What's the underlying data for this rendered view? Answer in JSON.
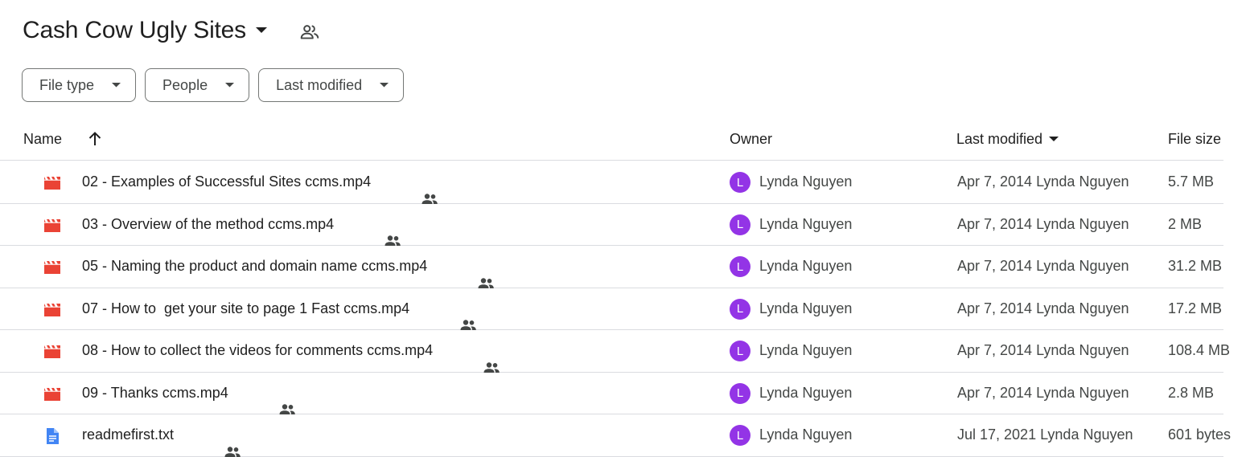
{
  "header": {
    "title": "Cash Cow Ugly Sites",
    "title_caret_icon": "caret-down-icon",
    "share_icon": "people-outline-icon"
  },
  "filters": [
    {
      "label": "File type"
    },
    {
      "label": "People"
    },
    {
      "label": "Last modified"
    }
  ],
  "columns": {
    "name": "Name",
    "owner": "Owner",
    "modified": "Last modified",
    "size": "File size"
  },
  "colors": {
    "video_icon": "#ea4335",
    "doc_icon": "#4285f4",
    "avatar": "#9334e6"
  },
  "files": [
    {
      "icon": "video-icon",
      "name": "02 - Examples of Successful Sites ccms.mp4",
      "owner_initial": "L",
      "owner": "Lynda Nguyen",
      "modified": "Apr 7, 2014 Lynda Nguyen",
      "size": "5.7 MB"
    },
    {
      "icon": "video-icon",
      "name": "03 - Overview of the method ccms.mp4",
      "owner_initial": "L",
      "owner": "Lynda Nguyen",
      "modified": "Apr 7, 2014 Lynda Nguyen",
      "size": "2 MB"
    },
    {
      "icon": "video-icon",
      "name": "05 - Naming the product and domain name ccms.mp4",
      "owner_initial": "L",
      "owner": "Lynda Nguyen",
      "modified": "Apr 7, 2014 Lynda Nguyen",
      "size": "31.2 MB"
    },
    {
      "icon": "video-icon",
      "name": "07 - How to  get your site to page 1 Fast ccms.mp4",
      "owner_initial": "L",
      "owner": "Lynda Nguyen",
      "modified": "Apr 7, 2014 Lynda Nguyen",
      "size": "17.2 MB"
    },
    {
      "icon": "video-icon",
      "name": "08 - How to collect the videos for comments ccms.mp4",
      "owner_initial": "L",
      "owner": "Lynda Nguyen",
      "modified": "Apr 7, 2014 Lynda Nguyen",
      "size": "108.4 MB"
    },
    {
      "icon": "video-icon",
      "name": "09 - Thanks ccms.mp4",
      "owner_initial": "L",
      "owner": "Lynda Nguyen",
      "modified": "Apr 7, 2014 Lynda Nguyen",
      "size": "2.8 MB"
    },
    {
      "icon": "doc-icon",
      "name": "readmefirst.txt",
      "owner_initial": "L",
      "owner": "Lynda Nguyen",
      "modified": "Jul 17, 2021 Lynda Nguyen",
      "size": "601 bytes"
    }
  ]
}
